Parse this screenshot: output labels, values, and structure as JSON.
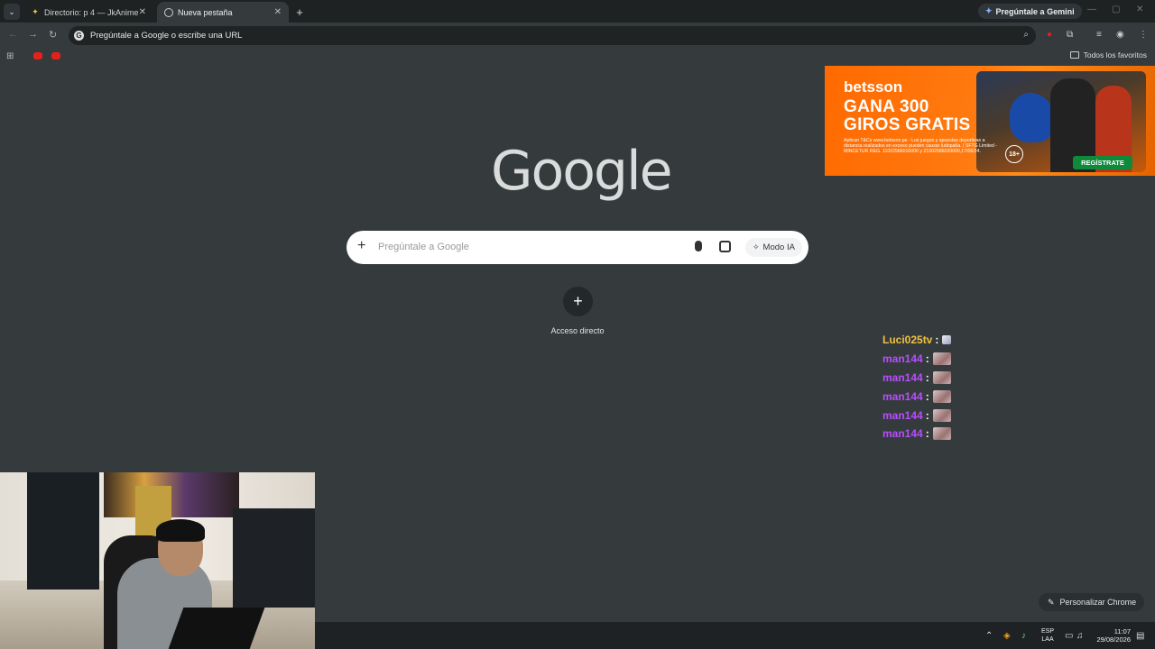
{
  "tabs": [
    {
      "label": "Directorio: p 4 — JkAnime",
      "close": "✕"
    },
    {
      "label": "Nueva pestaña",
      "close": "✕"
    }
  ],
  "new_tab_symbol": "+",
  "gemini_button": "Pregúntale a Gemini",
  "omnibox": {
    "text": "Pregúntale a Google o escribe una URL"
  },
  "bookmarks": {
    "all_label": "Todos los favoritos"
  },
  "ad": {
    "brand": "betsson",
    "headline1": "GANA 300",
    "headline2": "GIROS GRATIS",
    "legal": "Aplican T&Cs www.betsson.pe - Los juegos y apuestas deportivas a distancia realizados en exceso pueden causar ludopatía. | SFTG Limited - MINCETUR REG. 11002586010000 y 21002586020000,17/06/24.",
    "age": "18+",
    "cta": "REGÍSTRATE",
    "color": "#ff6a00"
  },
  "logo": "Google",
  "search": {
    "placeholder": "Pregúntale a Google",
    "mode_label": "Modo IA"
  },
  "shortcut": {
    "label": "Acceso directo"
  },
  "chat": [
    {
      "user": "Luci025tv",
      "color": "#f0c040",
      "emote": "small"
    },
    {
      "user": "man144",
      "color": "#b84dff",
      "emote": "large"
    },
    {
      "user": "man144",
      "color": "#b84dff",
      "emote": "large"
    },
    {
      "user": "man144",
      "color": "#b84dff",
      "emote": "large"
    },
    {
      "user": "man144",
      "color": "#b84dff",
      "emote": "large"
    },
    {
      "user": "man144",
      "color": "#b84dff",
      "emote": "large"
    }
  ],
  "customize_label": "Personalizar Chrome",
  "taskbar": {
    "lang1": "ESP",
    "lang2": "LAA",
    "time": "11:07",
    "date": "29/08/2026"
  }
}
